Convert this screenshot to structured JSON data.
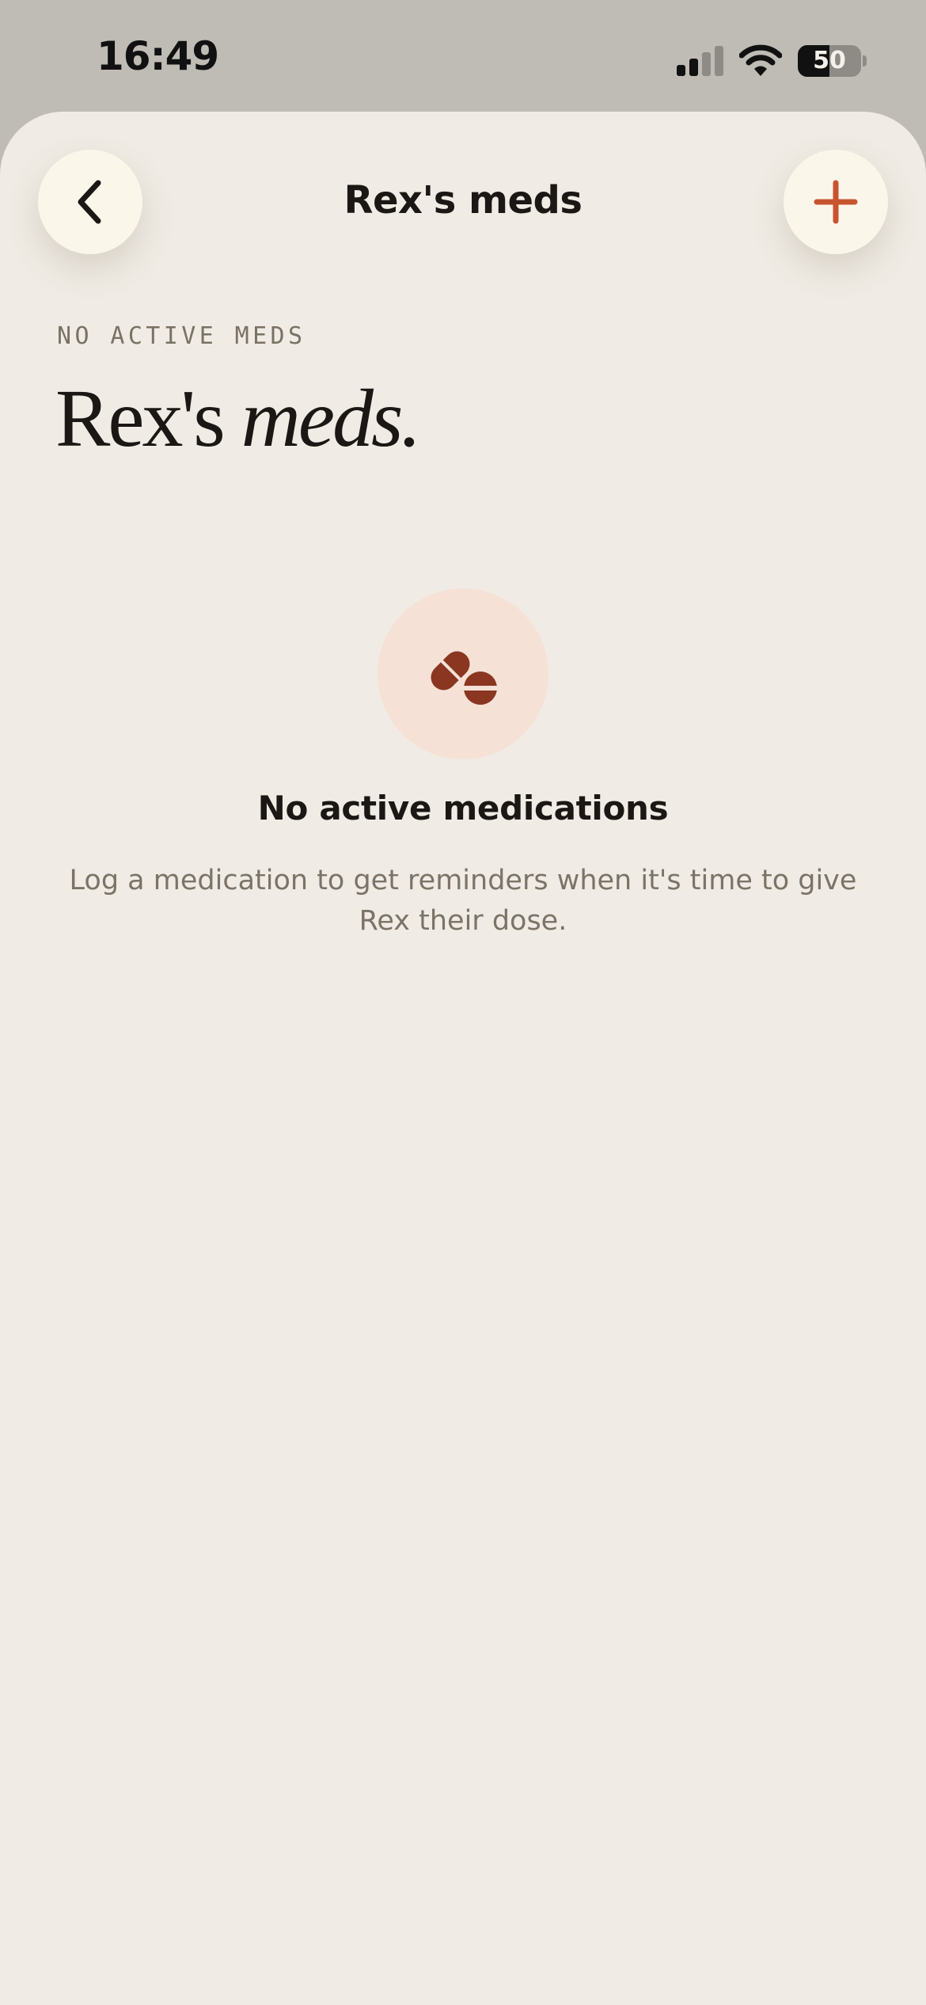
{
  "status_bar": {
    "time": "16:49",
    "battery_level": "50",
    "battery_fraction": 0.5
  },
  "nav": {
    "title": "Rex's meds",
    "back_icon": "chevron-left-icon",
    "add_icon": "plus-icon"
  },
  "header": {
    "eyebrow": "NO ACTIVE MEDS",
    "title_regular": "Rex's ",
    "title_italic": "meds."
  },
  "empty_state": {
    "icon": "pills-icon",
    "title": "No active medications",
    "description": "Log a medication to get reminders when it's time to give Rex their dose."
  },
  "colors": {
    "background": "#f0ece5",
    "accent": "#c8542f",
    "icon_circle": "#f6e1d6",
    "pill": "#8a3621",
    "button": "#fbf6ea"
  }
}
